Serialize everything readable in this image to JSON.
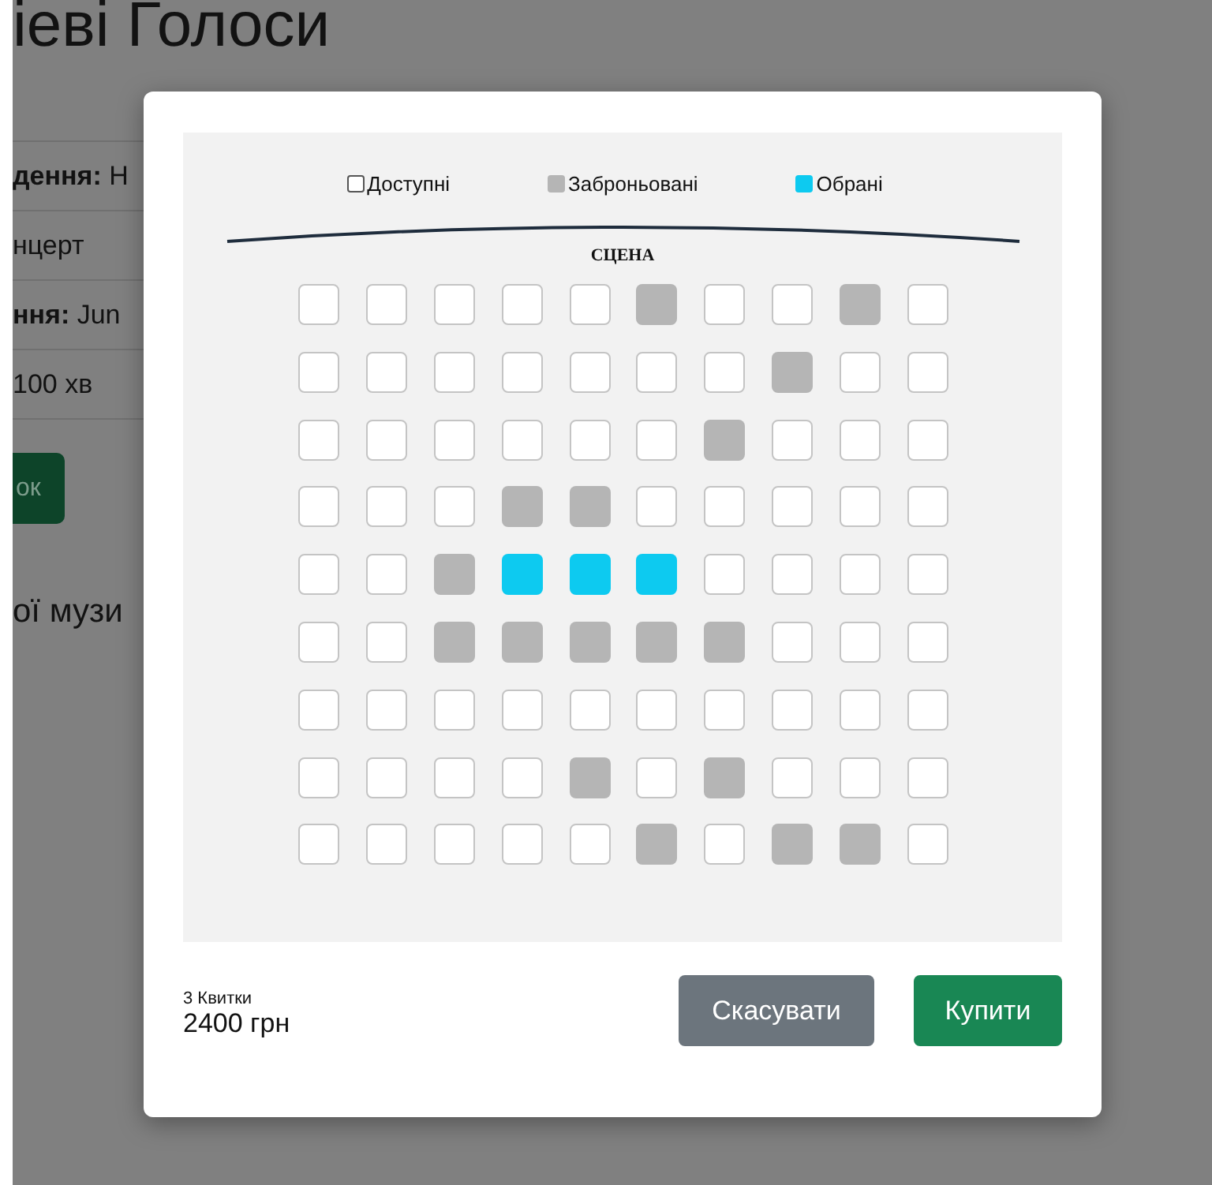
{
  "background_page": {
    "title": "іеві Голоси",
    "details": [
      "**дення:** Н",
      "нцерт",
      "**ння:** Jun",
      "100 хв"
    ],
    "button": "ок",
    "section_heading": "ої музи"
  },
  "seat_dialog": {
    "legend": [
      {
        "kind": "free",
        "label": "Доступні"
      },
      {
        "kind": "booked",
        "label": "Заброньовані"
      },
      {
        "kind": "selected",
        "label": "Обрані"
      }
    ],
    "stage_label": "СЦЕНА",
    "rows": [
      [
        {
          "kind": "free"
        },
        {
          "kind": "free"
        },
        {
          "kind": "free"
        },
        {
          "kind": "free"
        },
        {
          "kind": "free"
        },
        {
          "kind": "booked"
        },
        {
          "kind": "free"
        },
        {
          "kind": "free"
        },
        {
          "kind": "booked"
        },
        {
          "kind": "free"
        }
      ],
      [
        {
          "kind": "free"
        },
        {
          "kind": "free"
        },
        {
          "kind": "free"
        },
        {
          "kind": "free"
        },
        {
          "kind": "free"
        },
        {
          "kind": "free"
        },
        {
          "kind": "free"
        },
        {
          "kind": "booked"
        },
        {
          "kind": "free"
        },
        {
          "kind": "free"
        }
      ],
      [
        {
          "kind": "free"
        },
        {
          "kind": "free"
        },
        {
          "kind": "free"
        },
        {
          "kind": "free"
        },
        {
          "kind": "free"
        },
        {
          "kind": "free"
        },
        {
          "kind": "booked"
        },
        {
          "kind": "free"
        },
        {
          "kind": "free"
        },
        {
          "kind": "free"
        }
      ],
      [
        {
          "kind": "free"
        },
        {
          "kind": "free"
        },
        {
          "kind": "free"
        },
        {
          "kind": "booked"
        },
        {
          "kind": "booked"
        },
        {
          "kind": "free"
        },
        {
          "kind": "free"
        },
        {
          "kind": "free"
        },
        {
          "kind": "free"
        },
        {
          "kind": "free"
        }
      ],
      [
        {
          "kind": "free"
        },
        {
          "kind": "free"
        },
        {
          "kind": "booked"
        },
        {
          "kind": "selected"
        },
        {
          "kind": "selected"
        },
        {
          "kind": "selected"
        },
        {
          "kind": "free"
        },
        {
          "kind": "free"
        },
        {
          "kind": "free"
        },
        {
          "kind": "free"
        }
      ],
      [
        {
          "kind": "free"
        },
        {
          "kind": "free"
        },
        {
          "kind": "booked"
        },
        {
          "kind": "booked"
        },
        {
          "kind": "booked"
        },
        {
          "kind": "booked"
        },
        {
          "kind": "booked"
        },
        {
          "kind": "free"
        },
        {
          "kind": "free"
        },
        {
          "kind": "free"
        }
      ],
      [
        {
          "kind": "free"
        },
        {
          "kind": "free"
        },
        {
          "kind": "free"
        },
        {
          "kind": "free"
        },
        {
          "kind": "free"
        },
        {
          "kind": "free"
        },
        {
          "kind": "free"
        },
        {
          "kind": "free"
        },
        {
          "kind": "free"
        },
        {
          "kind": "free"
        }
      ],
      [
        {
          "kind": "free"
        },
        {
          "kind": "free"
        },
        {
          "kind": "free"
        },
        {
          "kind": "free"
        },
        {
          "kind": "booked"
        },
        {
          "kind": "free"
        },
        {
          "kind": "booked"
        },
        {
          "kind": "free"
        },
        {
          "kind": "free"
        },
        {
          "kind": "free"
        }
      ],
      [
        {
          "kind": "free"
        },
        {
          "kind": "free"
        },
        {
          "kind": "free"
        },
        {
          "kind": "free"
        },
        {
          "kind": "free"
        },
        {
          "kind": "booked"
        },
        {
          "kind": "free"
        },
        {
          "kind": "booked"
        },
        {
          "kind": "booked"
        },
        {
          "kind": "free"
        }
      ]
    ],
    "ticket_count": "3 Квитки",
    "total": "2400 грн",
    "buttons": [
      {
        "kind": "secondary",
        "label": "Скасувати"
      },
      {
        "kind": "primary",
        "label": "Купити"
      }
    ]
  }
}
